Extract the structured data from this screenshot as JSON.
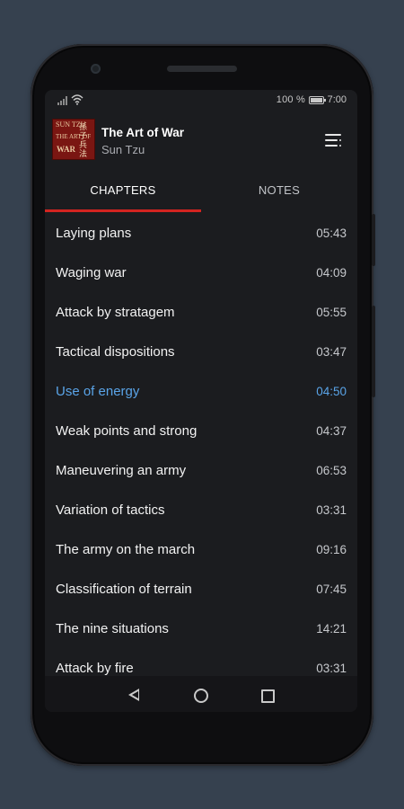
{
  "status_bar": {
    "battery_text": "100 %",
    "time": "7:00",
    "signal_icon": "signal-icon",
    "wifi_icon": "wifi-icon",
    "battery_icon": "battery-icon"
  },
  "book": {
    "title": "The Art of War",
    "author": "Sun Tzu",
    "cover": {
      "line1": "SUN TZU",
      "line2": "THE ART OF",
      "line3": "WAR",
      "glyphs": "孫子兵法"
    }
  },
  "tabs": [
    {
      "label": "CHAPTERS",
      "selected": true
    },
    {
      "label": "NOTES",
      "selected": false
    }
  ],
  "chapters": [
    {
      "name": "Laying plans",
      "duration": "05:43"
    },
    {
      "name": "Waging war",
      "duration": "04:09"
    },
    {
      "name": "Attack by stratagem",
      "duration": "05:55"
    },
    {
      "name": "Tactical dispositions",
      "duration": "03:47"
    },
    {
      "name": "Use of energy",
      "duration": "04:50",
      "active": true
    },
    {
      "name": "Weak points and strong",
      "duration": "04:37"
    },
    {
      "name": "Maneuvering an army",
      "duration": "06:53"
    },
    {
      "name": "Variation of tactics",
      "duration": "03:31"
    },
    {
      "name": "The army on the march",
      "duration": "09:16"
    },
    {
      "name": "Classification of terrain",
      "duration": "07:45"
    },
    {
      "name": "The nine situations",
      "duration": "14:21"
    },
    {
      "name": "Attack by fire",
      "duration": "03:31"
    }
  ],
  "colors": {
    "accent": "#d32420",
    "active_text": "#5aa4e8",
    "background": "#1b1c1f"
  },
  "nav_icons": [
    "back-icon",
    "home-icon",
    "recents-icon"
  ]
}
